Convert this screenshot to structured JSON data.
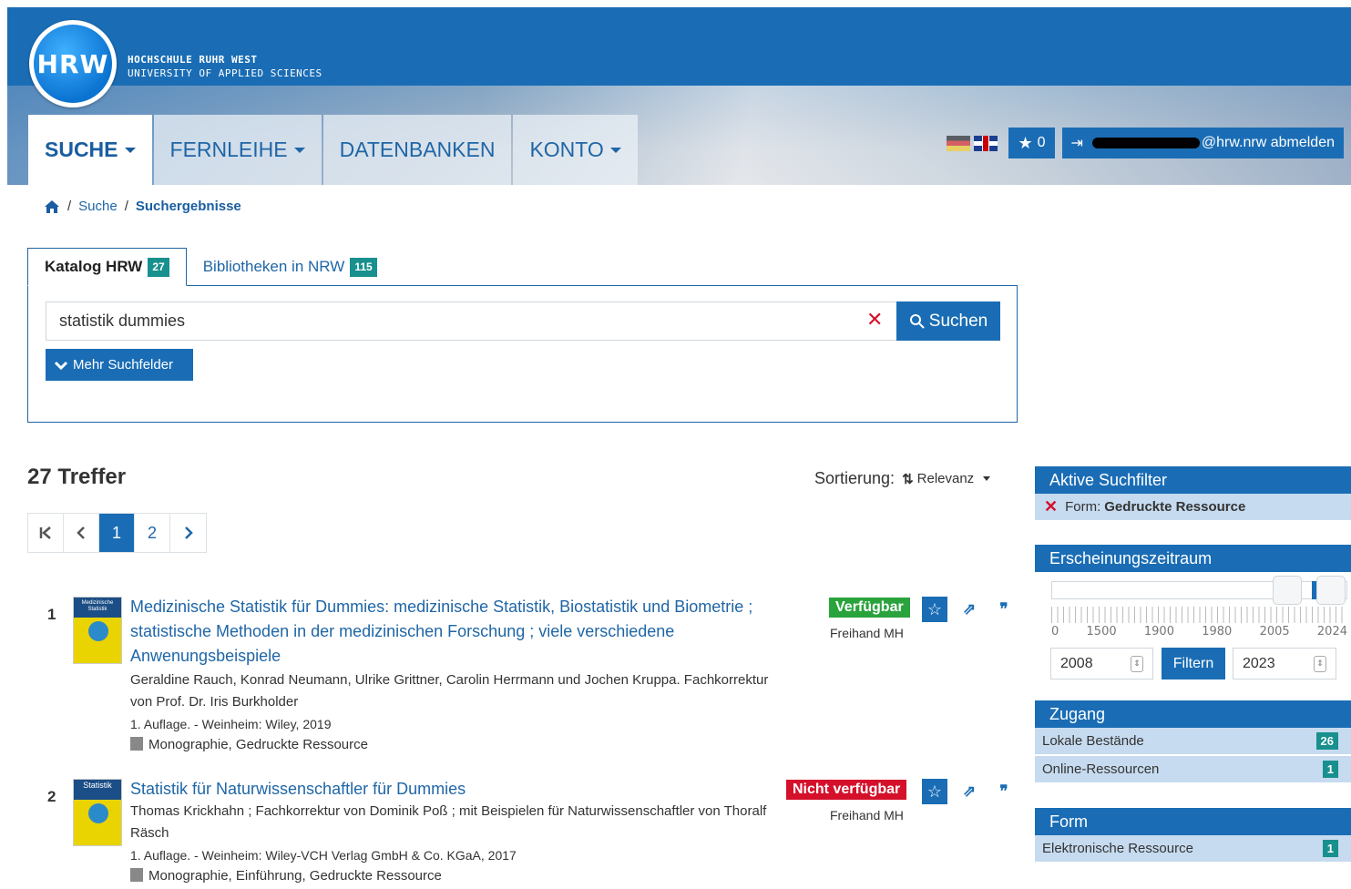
{
  "header": {
    "logo_text": "HRW",
    "brand_line1": "HOCHSCHULE RUHR WEST",
    "brand_line2": "UNIVERSITY OF APPLIED SCIENCES",
    "nav": [
      {
        "label": "SUCHE",
        "active": true
      },
      {
        "label": "FERNLEIHE"
      },
      {
        "label": "DATENBANKEN"
      },
      {
        "label": "KONTO"
      }
    ],
    "favorites_count": "0",
    "account_label": "@hrw.nrw abmelden"
  },
  "breadcrumb": {
    "item1": "Suche",
    "sep1": "/",
    "sep2": "/",
    "current": "Suchergebnisse"
  },
  "search": {
    "tab1_label": "Katalog HRW",
    "tab1_count": "27",
    "tab2_label": "Bibliotheken in NRW",
    "tab2_count": "115",
    "query": "statistik dummies",
    "clear": "✕",
    "search_button": "Suchen",
    "more_fields": "Mehr Suchfelder"
  },
  "results_header": {
    "hits": "27 Treffer",
    "sort_label": "Sortierung:",
    "sort_value": "Relevanz"
  },
  "pager": {
    "page1": "1",
    "page2": "2"
  },
  "results": [
    {
      "num": "1",
      "thumb_text": "Medizinische Statistik",
      "title": "Medizinische Statistik für Dummies: medizinische Statistik, Biostatistik und Biometrie ; statistische Methoden in der medizinischen Forschung ; viele verschiedene Anwenungsbeispiele",
      "authors": "Geraldine Rauch, Konrad Neumann, Ulrike Grittner, Carolin Herrmann und Jochen Kruppa. Fachkorrektur von Prof. Dr. Iris Burkholder",
      "edition": "1. Auflage. - Weinheim: Wiley, 2019",
      "type": "Monographie, Gedruckte Ressource",
      "status": "Verfügbar",
      "location": "Freihand MH"
    },
    {
      "num": "2",
      "thumb_text": "Statistik",
      "title": "Statistik für Naturwissenschaftler für Dummies",
      "authors": "Thomas Krickhahn ; Fachkorrektur von Dominik Poß ; mit Beispielen für Naturwissenschaftler von Thoralf Räsch",
      "edition": "1. Auflage. - Weinheim: Wiley-VCH Verlag GmbH & Co. KGaA, 2017",
      "type": "Monographie, Einführung, Gedruckte Ressource",
      "status": "Nicht verfügbar",
      "location": "Freihand MH"
    }
  ],
  "sidebar": {
    "active_filters_title": "Aktive Suchfilter",
    "active_filter_key": "Form:",
    "active_filter_value": "Gedruckte Ressource",
    "period_title": "Erscheinungszeitraum",
    "tick_labels": [
      "0",
      "1500",
      "1900",
      "1980",
      "2005",
      "2024"
    ],
    "year_from": "2008",
    "year_to": "2023",
    "filter_button": "Filtern",
    "access_title": "Zugang",
    "access_items": [
      {
        "label": "Lokale Bestände",
        "count": "26"
      },
      {
        "label": "Online-Ressourcen",
        "count": "1"
      }
    ],
    "form_title": "Form",
    "form_items": [
      {
        "label": "Elektronische Ressource",
        "count": "1"
      }
    ]
  },
  "colors": {
    "primary": "#1a6db5",
    "teal_badge": "#17908e",
    "available": "#2aa33c",
    "unavailable": "#d5102a"
  }
}
